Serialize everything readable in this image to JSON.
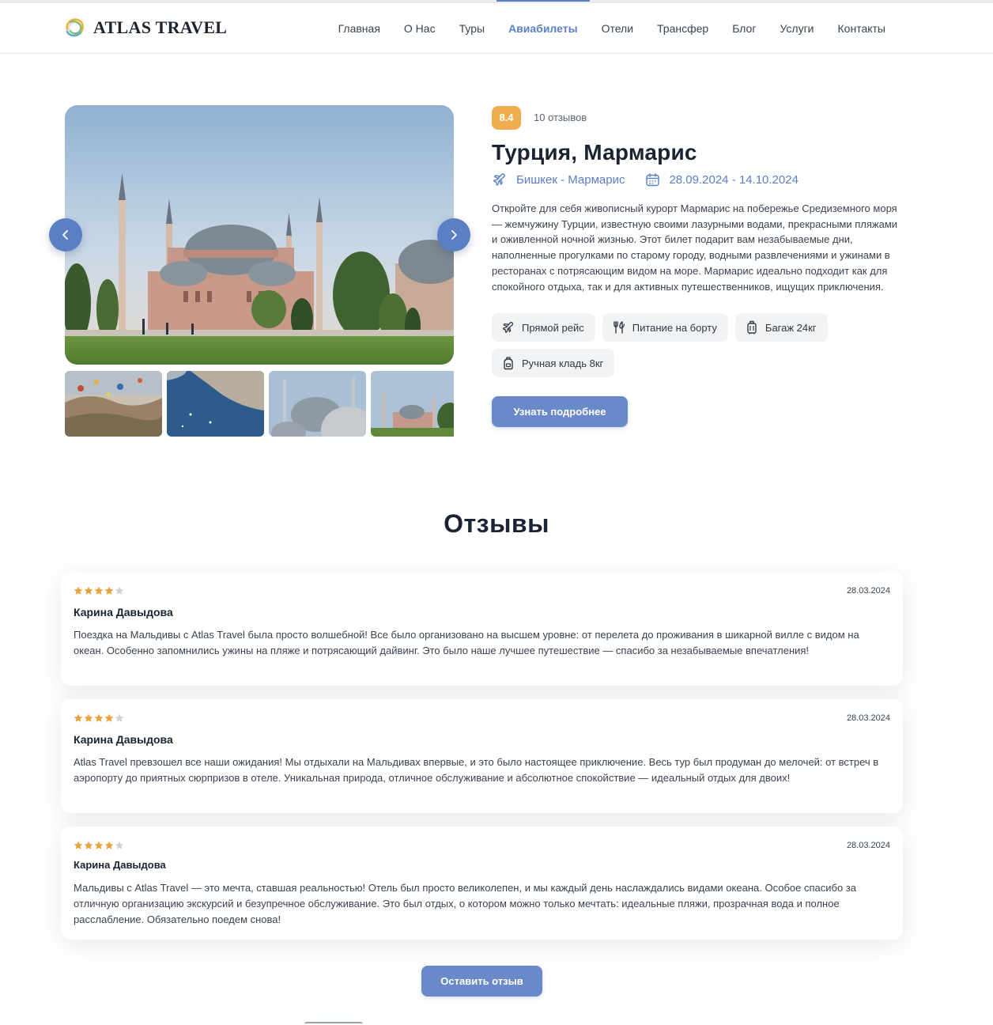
{
  "brand": {
    "name": "ATLAS TRAVEL"
  },
  "nav": {
    "items": [
      "Главная",
      "О Нас",
      "Туры",
      "Авиабилеты",
      "Отели",
      "Трансфер",
      "Блог",
      "Услуги",
      "Контакты"
    ],
    "active": "Авиабилеты"
  },
  "tour": {
    "rating": "8.4",
    "reviews_count": "10 отзывов",
    "title": "Турция, Мармарис",
    "route": "Бишкек - Мармарис",
    "dates": "28.09.2024 - 14.10.2024",
    "description": "Откройте для себя живописный курорт Мармарис на побережье Средиземного моря — жемчужину Турции, известную своими лазурными водами, прекрасными пляжами и оживленной ночной жизнью. Этот билет подарит вам незабываемые дни, наполненные прогулками по старому городу, водными развлечениями и ужинами в ресторанах с потрясающим видом на море. Мармарис идеально подходит как для спокойного отдыха, так и для активных путешественников, ищущих приключения.",
    "features": [
      {
        "icon": "plane-icon",
        "label": "Прямой рейс"
      },
      {
        "icon": "cutlery-icon",
        "label": "Питание на борту"
      },
      {
        "icon": "luggage-icon",
        "label": "Багаж 24кг"
      },
      {
        "icon": "backpack-icon",
        "label": "Ручная кладь 8кг"
      }
    ],
    "more_button": "Узнать подробнее"
  },
  "gallery": {
    "main_photo": "hagia-sophia",
    "thumbnails": [
      "cappadocia-balloons",
      "bosphorus-coast",
      "mosque-domes",
      "hagia-sophia"
    ]
  },
  "reviews": {
    "title": "Отзывы",
    "items": [
      {
        "stars": 4,
        "max_stars": 5,
        "date": "28.03.2024",
        "name": "Карина Давыдова",
        "text": "Поездка на Мальдивы с Atlas Travel была просто волшебной! Все было организовано на высшем уровне: от перелета до проживания в шикарной вилле с видом на океан. Особенно запомнились ужины на пляже и потрясающий дайвинг. Это было наше лучшее путешествие — спасибо за незабываемые впечатления!"
      },
      {
        "stars": 4,
        "max_stars": 5,
        "date": "28.03.2024",
        "name": "Карина Давыдова",
        "text": "Atlas Travel превзошел все наши ожидания! Мы отдыхали на Мальдивах впервые, и это было настоящее приключение. Весь тур был продуман до мелочей: от встреч в аэропорту до приятных сюрпризов в отеле. Уникальная природа, отличное обслуживание и абсолютное спокойствие — идеальный отдых для двоих!"
      },
      {
        "stars": 4,
        "max_stars": 5,
        "date": "28.03.2024",
        "name": "Карина Давыдова",
        "text": "Мальдивы с Atlas Travel — это мечта, ставшая реальностью! Отель был просто великолепен, и мы каждый день наслаждались видами океана. Особое спасибо за отличную организацию экскурсий и безупречное обслуживание. Это был отдых, о котором можно только мечтать: идеальные пляжи, прозрачная вода и полное расслабление. Обязательно поедем снова!"
      }
    ],
    "leave_button": "Оставить отзыв"
  },
  "colors": {
    "accent": "#5a7fc4",
    "button": "#6a89c9",
    "rating": "#f0ad4e",
    "star_filled": "#e8a23a",
    "star_empty": "#cfd3d8",
    "chip_bg": "#f2f3f5"
  }
}
